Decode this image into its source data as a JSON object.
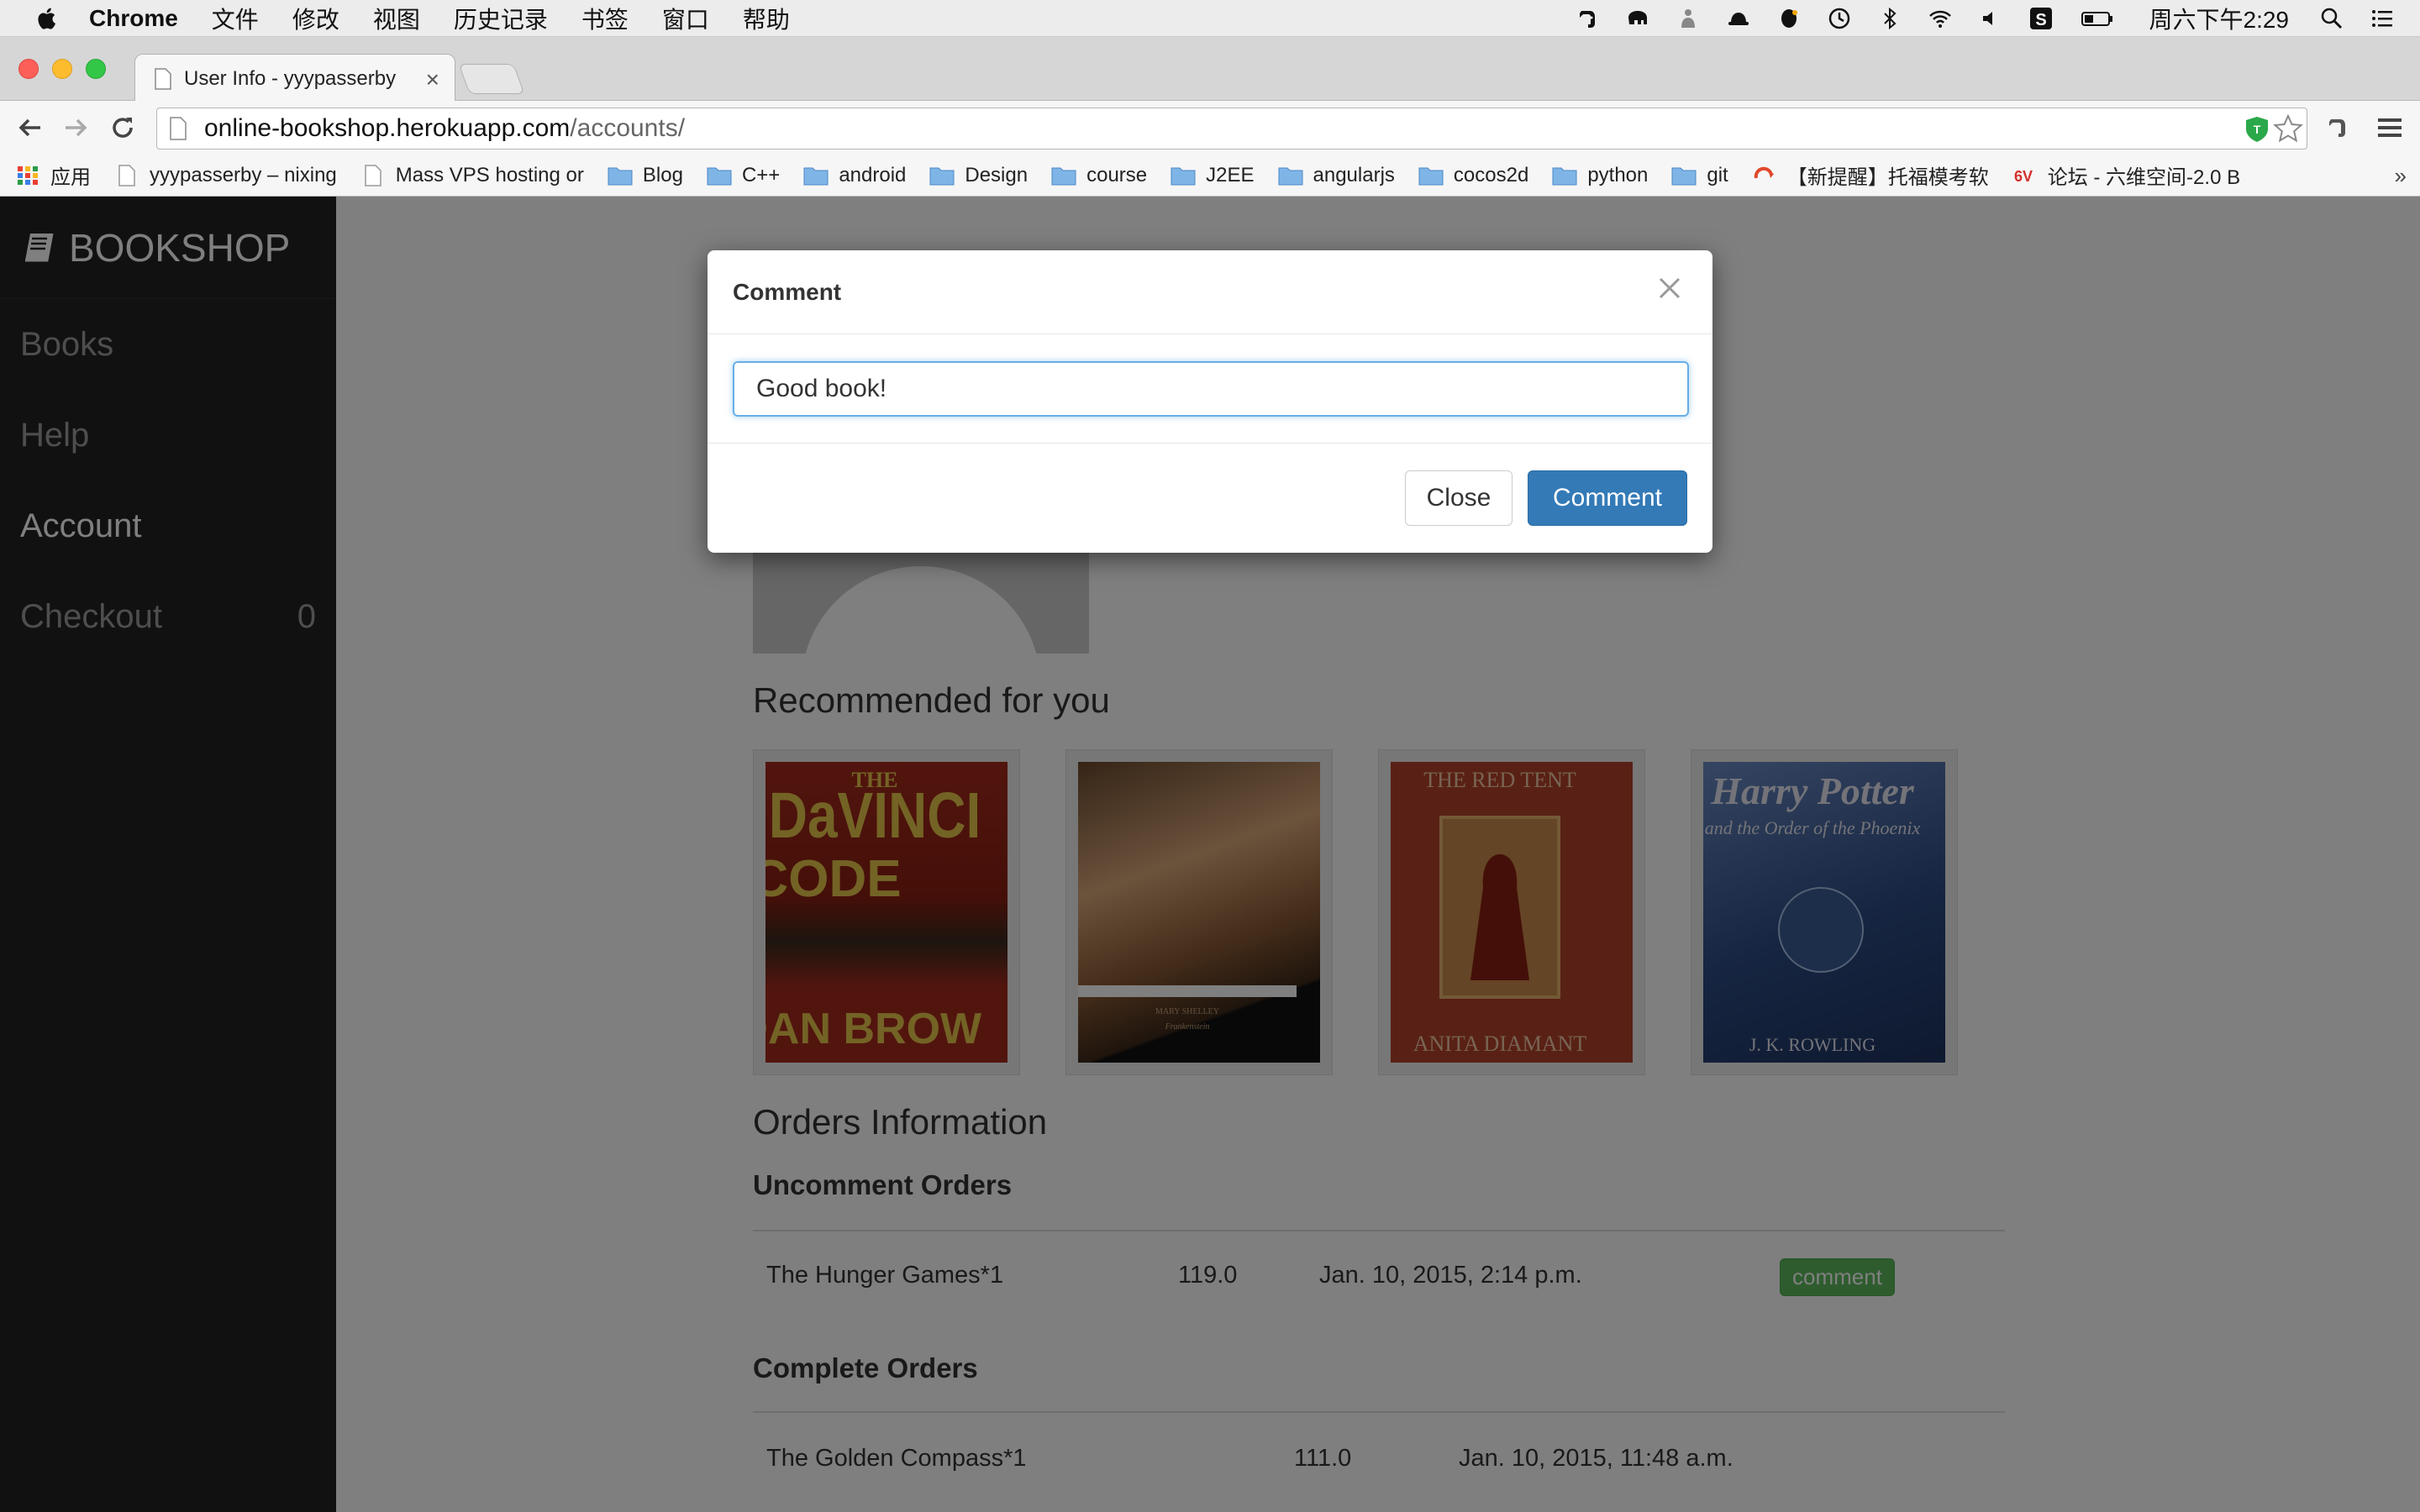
{
  "menubar": {
    "app_name": "Chrome",
    "items": [
      "文件",
      "修改",
      "视图",
      "历史记录",
      "书签",
      "窗口",
      "帮助"
    ],
    "clock": "周六下午2:29"
  },
  "browser": {
    "tab_title": "User Info - yyypasserby",
    "tab_close": "×",
    "url_host": "online-bookshop.herokuapp.com",
    "url_path": "/accounts/",
    "bookmarks": [
      {
        "label": "应用",
        "icon": "apps-grid-icon"
      },
      {
        "label": "yyypasserby – nixing",
        "icon": "page-icon"
      },
      {
        "label": "Mass VPS hosting or",
        "icon": "page-icon"
      },
      {
        "label": "Blog",
        "icon": "folder-icon"
      },
      {
        "label": "C++",
        "icon": "folder-icon"
      },
      {
        "label": "android",
        "icon": "folder-icon"
      },
      {
        "label": "Design",
        "icon": "folder-icon"
      },
      {
        "label": "course",
        "icon": "folder-icon"
      },
      {
        "label": "J2EE",
        "icon": "folder-icon"
      },
      {
        "label": "angularjs",
        "icon": "folder-icon"
      },
      {
        "label": "cocos2d",
        "icon": "folder-icon"
      },
      {
        "label": "python",
        "icon": "folder-icon"
      },
      {
        "label": "git",
        "icon": "folder-icon"
      },
      {
        "label": "【新提醒】托福模考软",
        "icon": "loop-icon"
      },
      {
        "label": "论坛 - 六维空间-2.0 B",
        "icon": "6v-icon"
      }
    ],
    "bookmarks_more": "»"
  },
  "sidebar": {
    "brand": "BOOKSHOP",
    "items": [
      {
        "label": "Books",
        "count": ""
      },
      {
        "label": "Help",
        "count": ""
      },
      {
        "label": "Account",
        "count": ""
      },
      {
        "label": "Checkout",
        "count": "0"
      }
    ]
  },
  "main": {
    "recommended_heading": "Recommended for you",
    "books": [
      {
        "title": "THE DA VINCI CODE",
        "author": "DAN BROWN",
        "color": "#b32a1c"
      },
      {
        "title": "Frankenstein",
        "author": "MARY SHELLEY",
        "color": "#111111"
      },
      {
        "title": "THE RED TENT",
        "author": "ANITA DIAMANT",
        "color": "#a33a24"
      },
      {
        "title": "Harry Potter and the Order of the Phoenix",
        "author": "J. K. ROWLING",
        "color": "#3d5f9c"
      }
    ],
    "orders_heading": "Orders Information",
    "uncomment_heading": "Uncomment Orders",
    "uncomment_orders": [
      {
        "item": "The Hunger Games*1",
        "price": "119.0",
        "date": "Jan. 10, 2015, 2:14 p.m.",
        "action": "comment"
      }
    ],
    "complete_heading": "Complete Orders",
    "complete_orders": [
      {
        "item": "The Golden Compass*1",
        "price": "111.0",
        "date": "Jan. 10, 2015, 11:48 a.m."
      }
    ]
  },
  "modal": {
    "title": "Comment",
    "input_value": "Good book!",
    "close_label": "Close",
    "submit_label": "Comment"
  },
  "colors": {
    "sidebar_bg": "#222222",
    "primary": "#337ab7",
    "success": "#5cb85c"
  }
}
